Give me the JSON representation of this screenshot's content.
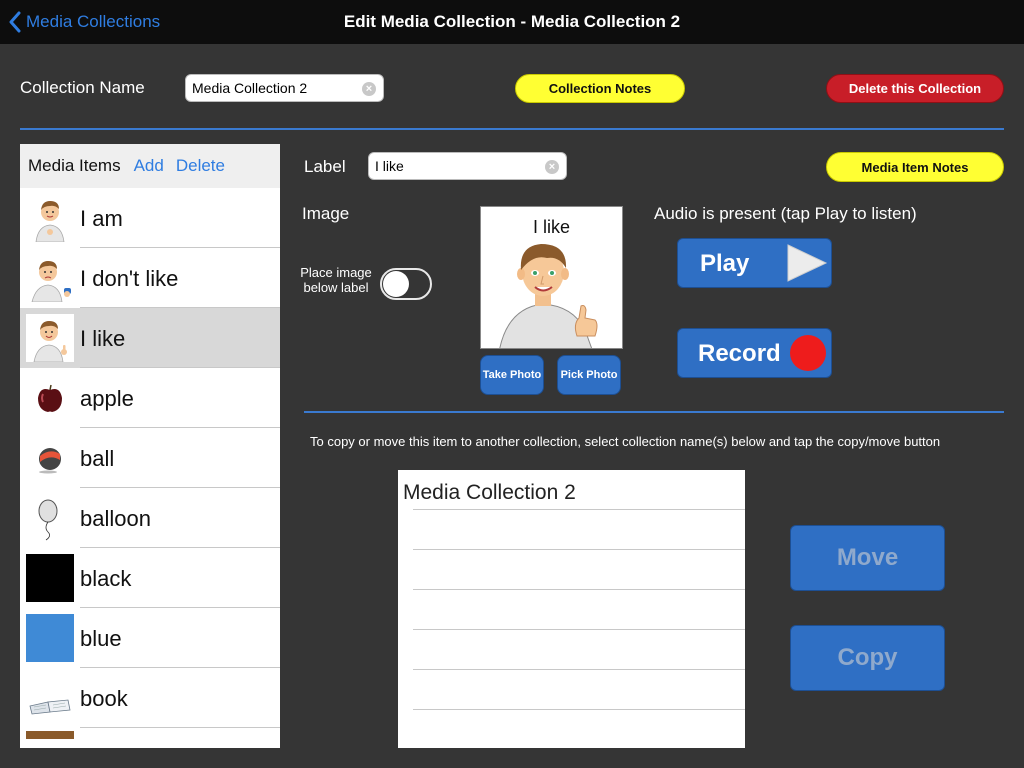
{
  "navbar": {
    "back_label": "Media Collections",
    "title": "Edit Media Collection - Media Collection 2"
  },
  "collection": {
    "name_label": "Collection Name",
    "name_value": "Media Collection 2",
    "notes_button": "Collection Notes",
    "delete_button": "Delete this Collection"
  },
  "media_list": {
    "title": "Media Items",
    "add": "Add",
    "delete": "Delete",
    "items": [
      {
        "label": "I am",
        "icon": "boy-pointing-self-icon"
      },
      {
        "label": "I don't like",
        "icon": "boy-thumbs-down-icon"
      },
      {
        "label": "I like",
        "icon": "boy-thumbs-up-icon",
        "selected": true
      },
      {
        "label": "apple",
        "icon": "apple-icon"
      },
      {
        "label": "ball",
        "icon": "ball-icon"
      },
      {
        "label": "balloon",
        "icon": "balloon-icon"
      },
      {
        "label": "black",
        "icon": "black-swatch-icon",
        "color": "#000000"
      },
      {
        "label": "blue",
        "icon": "blue-swatch-icon",
        "color": "#3f8ad6"
      },
      {
        "label": "book",
        "icon": "book-icon"
      },
      {
        "label": "",
        "icon": "partial-item-icon"
      }
    ]
  },
  "item_editor": {
    "label_caption": "Label",
    "label_value": "I like",
    "notes_button": "Media Item Notes",
    "image_caption": "Image",
    "toggle_caption": "Place image below label",
    "toggle_on": false,
    "image_text": "I like",
    "take_photo": "Take Photo",
    "pick_photo": "Pick Photo",
    "audio_status": "Audio is present (tap Play to listen)",
    "play": "Play",
    "record": "Record"
  },
  "copy_move": {
    "instruction": "To copy or move this item to another collection, select collection name(s) below and tap the copy/move button",
    "collections": [
      "Media Collection 2",
      "",
      "",
      "",
      "",
      "",
      ""
    ],
    "move": "Move",
    "copy": "Copy"
  },
  "colors": {
    "accent": "#2f7de1",
    "button_blue": "#2f6fc4",
    "divider": "#3a7ad0",
    "yellow": "#ffff33",
    "red": "#c81e28",
    "background": "#353535"
  }
}
